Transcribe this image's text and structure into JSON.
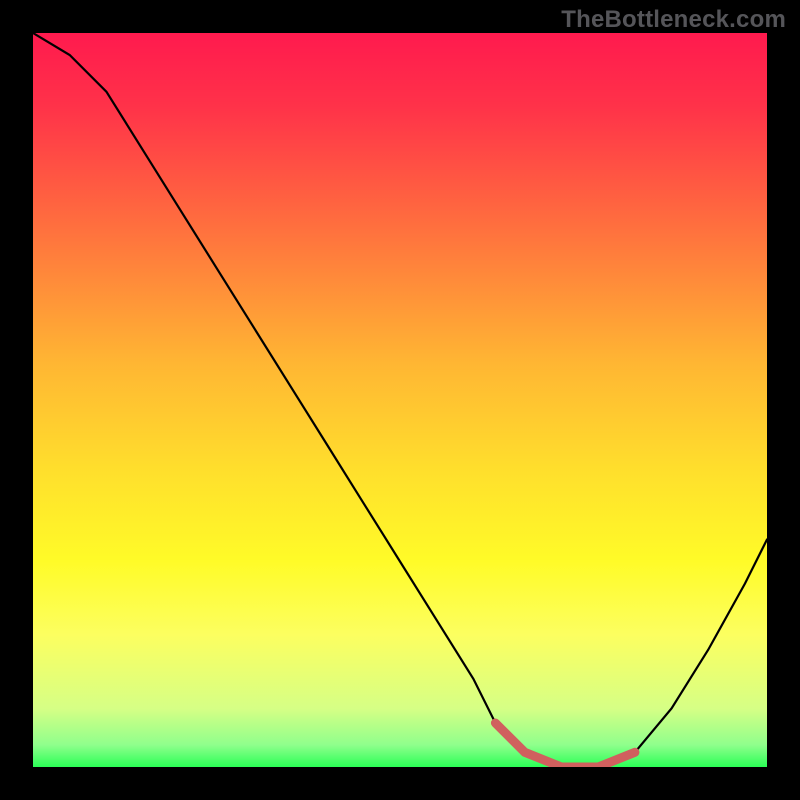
{
  "watermark": "TheBottleneck.com",
  "chart_data": {
    "type": "line",
    "title": "",
    "xlabel": "",
    "ylabel": "",
    "xlim": [
      0,
      100
    ],
    "ylim": [
      0,
      100
    ],
    "grid": false,
    "legend": false,
    "background_gradient": {
      "stops": [
        {
          "pos": 0.0,
          "color": "#ff1a4e"
        },
        {
          "pos": 0.1,
          "color": "#ff3249"
        },
        {
          "pos": 0.25,
          "color": "#ff6a3f"
        },
        {
          "pos": 0.45,
          "color": "#ffb633"
        },
        {
          "pos": 0.6,
          "color": "#ffe02c"
        },
        {
          "pos": 0.72,
          "color": "#fffb28"
        },
        {
          "pos": 0.82,
          "color": "#fcff60"
        },
        {
          "pos": 0.92,
          "color": "#d6ff85"
        },
        {
          "pos": 0.97,
          "color": "#8fff8c"
        },
        {
          "pos": 1.0,
          "color": "#2bff56"
        }
      ]
    },
    "series": [
      {
        "name": "bottleneck-curve",
        "x": [
          0,
          5,
          10,
          15,
          20,
          25,
          30,
          35,
          40,
          45,
          50,
          55,
          60,
          63,
          67,
          72,
          77,
          82,
          87,
          92,
          97,
          100
        ],
        "y": [
          100,
          97,
          92,
          84,
          76,
          68,
          60,
          52,
          44,
          36,
          28,
          20,
          12,
          6,
          2,
          0,
          0,
          2,
          8,
          16,
          25,
          31
        ]
      }
    ],
    "marker_region": {
      "name": "optimal-range",
      "x": [
        63,
        67,
        72,
        77,
        82
      ],
      "y": [
        6,
        2,
        0,
        0,
        2
      ]
    }
  }
}
